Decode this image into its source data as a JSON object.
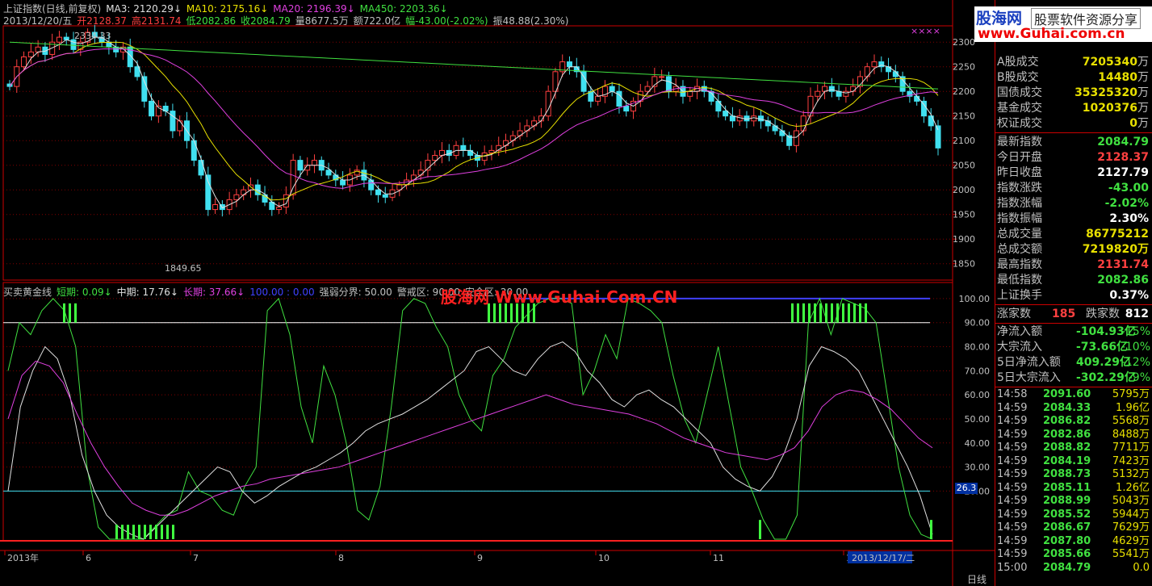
{
  "header": {
    "line1": [
      {
        "text": "上证指数(日线,前复权)",
        "color": "#c0c0c0"
      },
      {
        "text": "MA3: 2120.29↓",
        "color": "#e0e0e0"
      },
      {
        "text": "MA10: 2175.16↓",
        "color": "#e8e000"
      },
      {
        "text": "MA20: 2196.39↓",
        "color": "#e040e0"
      },
      {
        "text": "MA450: 2203.36↓",
        "color": "#40e040"
      }
    ],
    "line2": [
      {
        "text": "2013/12/20/五",
        "color": "#c0c0c0"
      },
      {
        "text": "开2128.37",
        "color": "#ff4040"
      },
      {
        "text": "高2131.74",
        "color": "#ff4040"
      },
      {
        "text": "低2082.86",
        "color": "#40e040"
      },
      {
        "text": "收2084.79",
        "color": "#40e040"
      },
      {
        "text": "量8677.5万",
        "color": "#c0c0c0"
      },
      {
        "text": "额722.0亿",
        "color": "#c0c0c0"
      },
      {
        "text": "幅-43.00(-2.02%)",
        "color": "#40e040"
      },
      {
        "text": "振48.88(2.30%)",
        "color": "#c0c0c0"
      }
    ],
    "ind": [
      {
        "text": "买卖黄金线",
        "color": "#c0c0c0"
      },
      {
        "text": "短期: 0.09↓",
        "color": "#40e040"
      },
      {
        "text": "中期: 17.76↓",
        "color": "#e0e0e0"
      },
      {
        "text": "长期: 37.66↓",
        "color": "#e040e0"
      },
      {
        "text": "100.00 : 0.00",
        "color": "#4040ff"
      },
      {
        "text": "强弱分界: 50.00",
        "color": "#c0c0c0"
      },
      {
        "text": "警戒区: 90.00",
        "color": "#c0c0c0"
      },
      {
        "text": "安全区: 20.00",
        "color": "#c0c0c0"
      }
    ],
    "dots": "××××",
    "watermark": "股海网 Www.Guhai.Com.CN"
  },
  "logo": {
    "cn": "股海网",
    "slogan": "股票软件资源分享",
    "url": "www.Guhai.com.cn"
  },
  "chart_data": [
    {
      "type": "candlestick",
      "title": "上证指数(日线,前复权)",
      "ylim": [
        1820,
        2320
      ],
      "yticks": [
        1850,
        1900,
        1950,
        2000,
        2050,
        2100,
        2150,
        2200,
        2250,
        2300
      ],
      "xticks": [
        "2013年",
        "6",
        "7",
        "8",
        "9",
        "10",
        "11",
        "1",
        "2013/12/17/二"
      ],
      "annotations": [
        {
          "text": "2334.33"
        },
        {
          "text": "1849.65"
        }
      ],
      "ma_series": [
        {
          "name": "MA3",
          "color": "#e0e0e0"
        },
        {
          "name": "MA10",
          "color": "#e8e000"
        },
        {
          "name": "MA20",
          "color": "#e040e0"
        },
        {
          "name": "MA450",
          "color": "#40e040"
        }
      ],
      "close": [
        2210,
        2250,
        2270,
        2280,
        2290,
        2275,
        2300,
        2310,
        2305,
        2285,
        2300,
        2320,
        2310,
        2300,
        2290,
        2280,
        2290,
        2250,
        2230,
        2180,
        2150,
        2170,
        2160,
        2120,
        2140,
        2100,
        2060,
        2030,
        1960,
        1970,
        1960,
        1980,
        1990,
        2000,
        2010,
        1990,
        1975,
        1960,
        1965,
        1990,
        2060,
        2040,
        2050,
        2060,
        2040,
        2030,
        2020,
        2010,
        2030,
        2040,
        2020,
        2000,
        1990,
        1985,
        2000,
        2010,
        2020,
        2030,
        2040,
        2060,
        2070,
        2080,
        2070,
        2090,
        2080,
        2070,
        2060,
        2075,
        2080,
        2090,
        2100,
        2110,
        2120,
        2130,
        2140,
        2150,
        2200,
        2240,
        2260,
        2250,
        2240,
        2200,
        2180,
        2190,
        2210,
        2200,
        2170,
        2160,
        2180,
        2200,
        2210,
        2230,
        2230,
        2200,
        2210,
        2190,
        2200,
        2210,
        2200,
        2180,
        2160,
        2150,
        2140,
        2150,
        2140,
        2150,
        2140,
        2130,
        2120,
        2110,
        2090,
        2120,
        2150,
        2190,
        2200,
        2210,
        2200,
        2190,
        2200,
        2210,
        2230,
        2250,
        2260,
        2250,
        2240,
        2230,
        2200,
        2190,
        2180,
        2150,
        2130,
        2085
      ]
    },
    {
      "type": "line",
      "title": "买卖黄金线",
      "ylim": [
        0,
        105
      ],
      "yticks": [
        20,
        30,
        40,
        50,
        60,
        70,
        80,
        90,
        100
      ],
      "series": [
        {
          "name": "短期",
          "color": "#40e040",
          "values": [
            70,
            90,
            85,
            95,
            100,
            95,
            80,
            30,
            5,
            0,
            0,
            0,
            0,
            5,
            10,
            12,
            28,
            20,
            18,
            12,
            10,
            22,
            30,
            95,
            100,
            85,
            55,
            40,
            72,
            60,
            40,
            12,
            8,
            22,
            55,
            95,
            100,
            98,
            88,
            80,
            60,
            50,
            45,
            68,
            75,
            88,
            93,
            98,
            100,
            100,
            98,
            60,
            70,
            85,
            75,
            100,
            98,
            95,
            90,
            68,
            50,
            40,
            60,
            80,
            55,
            30,
            20,
            8,
            0,
            0,
            10,
            90,
            100,
            85,
            100,
            98,
            96,
            90,
            60,
            30,
            10,
            2,
            0
          ]
        },
        {
          "name": "中期",
          "color": "#e0e0e0",
          "values": [
            20,
            55,
            70,
            80,
            75,
            60,
            35,
            20,
            10,
            5,
            2,
            0,
            5,
            10,
            15,
            20,
            25,
            30,
            28,
            20,
            15,
            18,
            22,
            25,
            28,
            30,
            33,
            36,
            40,
            45,
            48,
            50,
            52,
            55,
            58,
            62,
            66,
            70,
            78,
            80,
            75,
            70,
            68,
            75,
            80,
            82,
            78,
            70,
            65,
            58,
            55,
            60,
            62,
            58,
            55,
            50,
            45,
            40,
            30,
            25,
            22,
            20,
            26,
            36,
            50,
            72,
            80,
            78,
            75,
            70,
            60,
            50,
            40,
            30,
            18,
            2
          ]
        },
        {
          "name": "长期",
          "color": "#e040e0",
          "values": [
            50,
            68,
            74,
            72,
            65,
            52,
            40,
            30,
            22,
            15,
            12,
            10,
            10,
            12,
            15,
            18,
            20,
            22,
            23,
            25,
            26,
            27,
            28,
            29,
            30,
            32,
            34,
            36,
            38,
            40,
            42,
            44,
            46,
            48,
            50,
            52,
            54,
            56,
            58,
            60,
            58,
            56,
            55,
            54,
            53,
            52,
            50,
            48,
            45,
            42,
            40,
            38,
            36,
            35,
            34,
            33,
            35,
            38,
            45,
            55,
            60,
            62,
            61,
            58,
            54,
            48,
            42,
            38
          ]
        }
      ]
    }
  ],
  "side_tag": "26.3",
  "period": "日线",
  "panel": {
    "rows1": [
      {
        "k": "A股成交",
        "v": "7205340",
        "u": "万",
        "c": "#e8e000"
      },
      {
        "k": "B股成交",
        "v": "14480",
        "u": "万",
        "c": "#e8e000"
      },
      {
        "k": "国债成交",
        "v": "35325320",
        "u": "万",
        "c": "#e8e000"
      },
      {
        "k": "基金成交",
        "v": "1020376",
        "u": "万",
        "c": "#e8e000"
      },
      {
        "k": "权证成交",
        "v": "0",
        "u": "万",
        "c": "#e8e000"
      }
    ],
    "rows2": [
      {
        "k": "最新指数",
        "v": "2084.79",
        "c": "#40e040"
      },
      {
        "k": "今日开盘",
        "v": "2128.37",
        "c": "#ff4040"
      },
      {
        "k": "昨日收盘",
        "v": "2127.79",
        "c": "#ffffff"
      },
      {
        "k": "指数涨跌",
        "v": "-43.00",
        "c": "#40e040"
      },
      {
        "k": "指数涨幅",
        "v": "-2.02%",
        "c": "#40e040"
      },
      {
        "k": "指数振幅",
        "v": "2.30%",
        "c": "#ffffff"
      },
      {
        "k": "总成交量",
        "v": "86775212",
        "c": "#e8e000"
      },
      {
        "k": "总成交额",
        "v": "7219820万",
        "c": "#e8e000"
      },
      {
        "k": "最高指数",
        "v": "2131.74",
        "c": "#ff4040"
      },
      {
        "k": "最低指数",
        "v": "2082.86",
        "c": "#40e040"
      },
      {
        "k": "上证换手",
        "v": "0.37%",
        "c": "#ffffff"
      }
    ],
    "updown": {
      "up_label": "涨家数",
      "up": "185",
      "down_label": "跌家数",
      "down": "812"
    },
    "flows": [
      {
        "k": "净流入额",
        "v": "-104.93亿",
        "p": "-15%"
      },
      {
        "k": "大宗流入",
        "v": "-73.66亿",
        "p": "-10%"
      },
      {
        "k": "5日净流入额",
        "v": "409.29亿",
        "p": "-12%"
      },
      {
        "k": "5日大宗流入",
        "v": "-302.29亿",
        "p": "-9%"
      }
    ],
    "ticks": [
      {
        "t": "14:58",
        "p": "2091.60",
        "v": "5795万"
      },
      {
        "t": "14:59",
        "p": "2084.33",
        "v": "1.96亿"
      },
      {
        "t": "14:59",
        "p": "2086.82",
        "v": "5568万"
      },
      {
        "t": "14:59",
        "p": "2082.86",
        "v": "8488万"
      },
      {
        "t": "14:59",
        "p": "2088.82",
        "v": "7711万"
      },
      {
        "t": "14:59",
        "p": "2084.19",
        "v": "7423万"
      },
      {
        "t": "14:59",
        "p": "2088.73",
        "v": "5132万"
      },
      {
        "t": "14:59",
        "p": "2085.11",
        "v": "1.26亿"
      },
      {
        "t": "14:59",
        "p": "2088.99",
        "v": "5043万"
      },
      {
        "t": "14:59",
        "p": "2085.52",
        "v": "5944万"
      },
      {
        "t": "14:59",
        "p": "2086.67",
        "v": "7629万"
      },
      {
        "t": "14:59",
        "p": "2087.80",
        "v": "4629万"
      },
      {
        "t": "14:59",
        "p": "2085.66",
        "v": "5541万"
      },
      {
        "t": "15:00",
        "p": "2084.79",
        "v": "0.0"
      }
    ]
  }
}
